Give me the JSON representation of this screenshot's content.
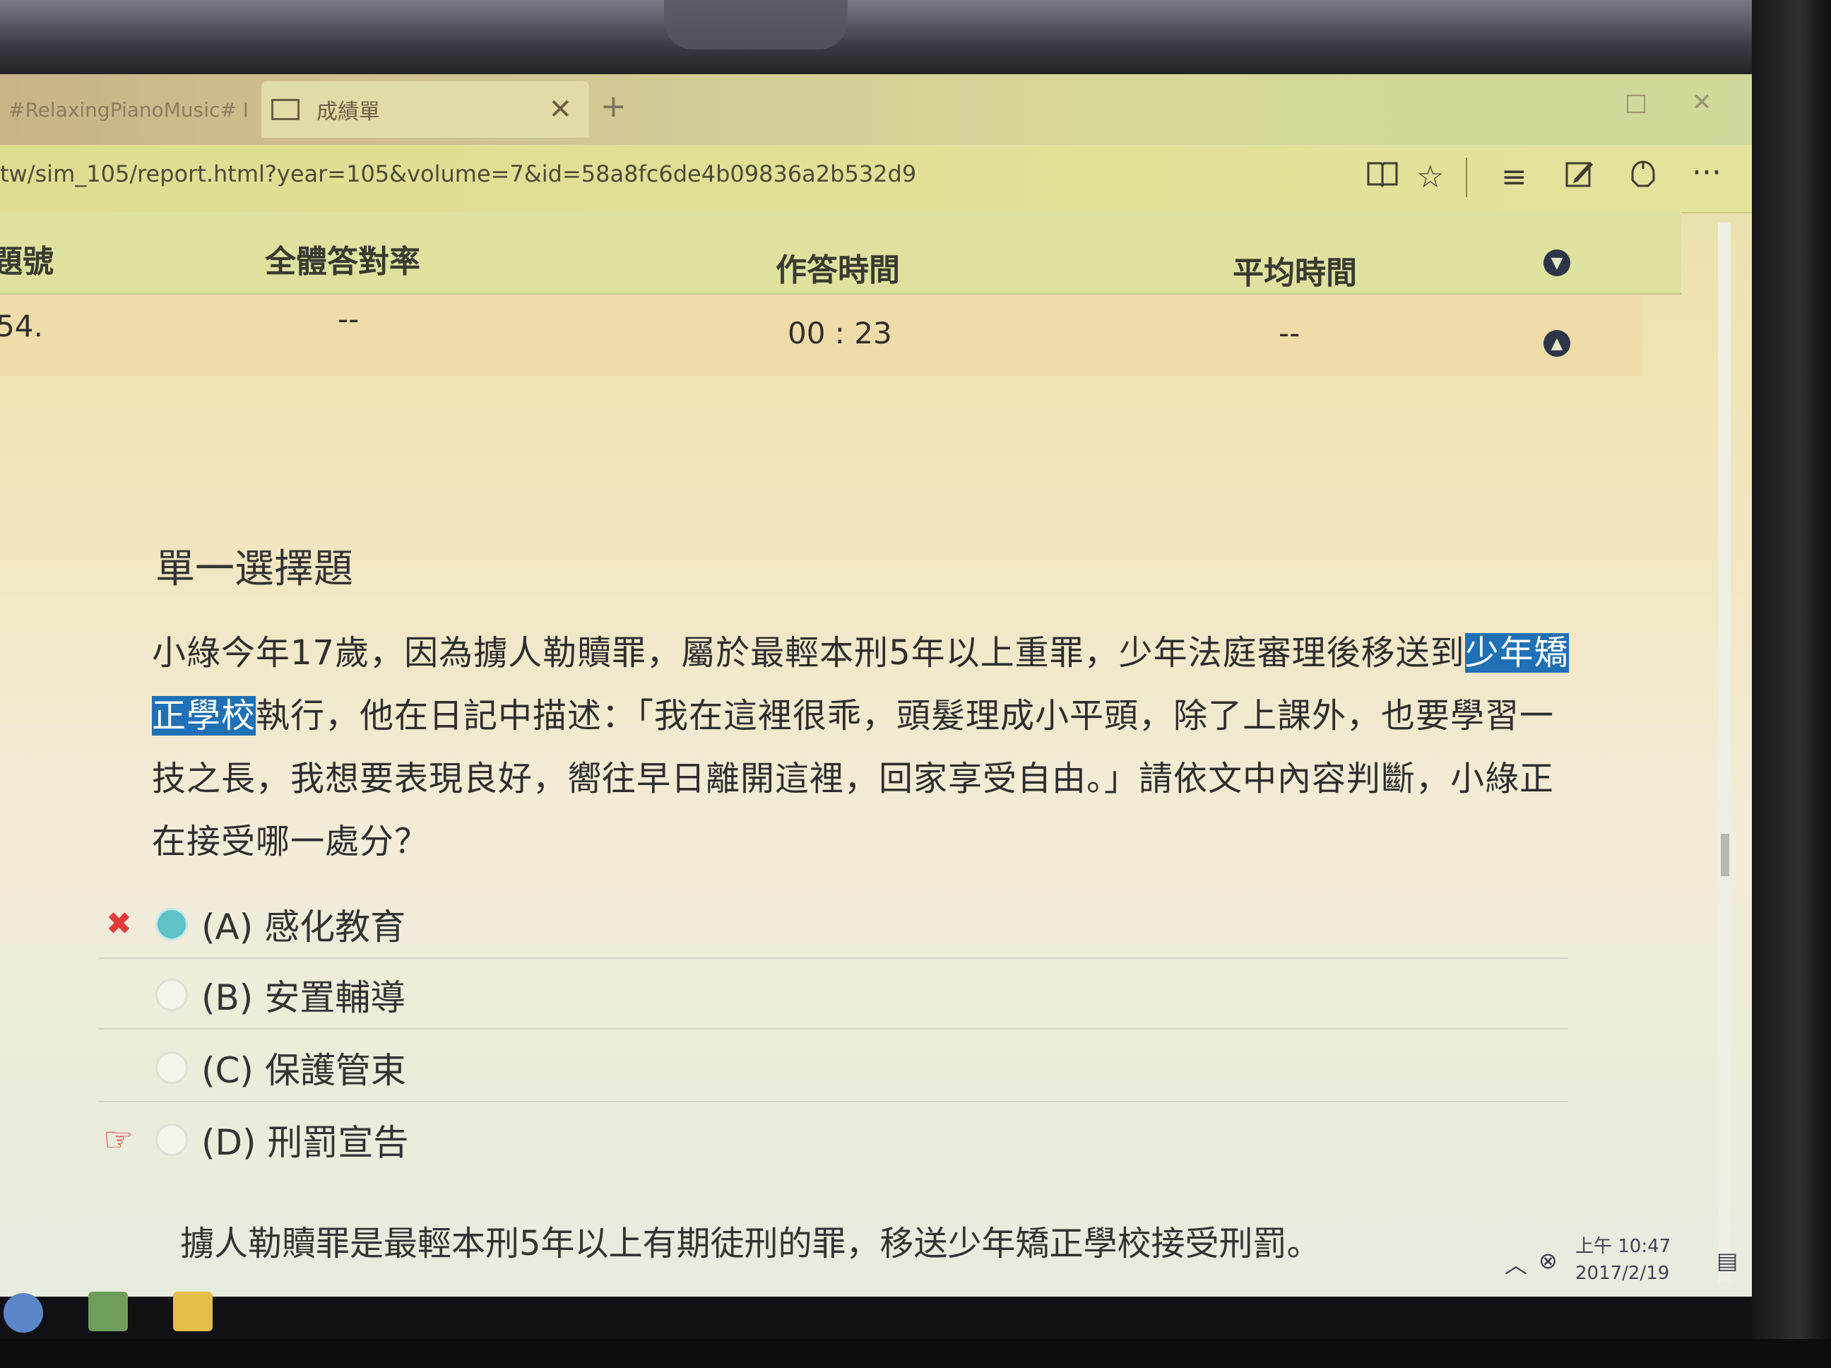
{
  "tabs": [
    {
      "label": "#RelaxingPianoMusic# I",
      "active": false
    },
    {
      "label": "成績單",
      "active": true
    }
  ],
  "new_tab_symbol": "+",
  "tab_close_symbol": "✕",
  "window_controls": {
    "restore": "□",
    "close": "✕"
  },
  "address": "tw/sim_105/report.html?year=105&volume=7&id=58a8fc6de4b09836a2b532d9",
  "toolbar": {
    "reading_view": "reading-view-icon",
    "favorite": "star-icon",
    "hub": "hub-icon",
    "web_note": "web-note-icon",
    "share": "share-icon",
    "more": "···"
  },
  "table": {
    "headers": {
      "number": "題號",
      "overall_correct_rate": "全體答對率",
      "answer_time": "作答時間",
      "average_time": "平均時間"
    },
    "row": {
      "number": "54.",
      "overall_correct_rate": "--",
      "answer_time": "00 : 23",
      "average_time": "--"
    }
  },
  "question": {
    "type": "單一選擇題",
    "text_before": "小綠今年17歲，因為擄人勒贖罪，屬於最輕本刑5年以上重罪，少年法庭審理後移送到",
    "highlighted": "少年矯正學校",
    "text_after": "執行，他在日記中描述：「我在這裡很乖，頭髮理成小平頭，除了上課外，也要學習一技之長，我想要表現良好，嚮往早日離開這裡，回家享受自由。」請依文中內容判斷，小綠正在接受哪一處分？"
  },
  "options": [
    {
      "label": "(A) 感化教育",
      "selected": true,
      "mark": "✖"
    },
    {
      "label": "(B) 安置輔導",
      "selected": false,
      "mark": ""
    },
    {
      "label": "(C) 保護管束",
      "selected": false,
      "mark": ""
    },
    {
      "label": "(D) 刑罰宣告",
      "selected": false,
      "mark": "☞"
    }
  ],
  "explanation": "擄人勒贖罪是最輕本刑5年以上有期徒刑的罪，移送少年矯正學校接受刑罰。",
  "system_tray": {
    "time": "上午 10:47",
    "date": "2017/2/19"
  },
  "colors": {
    "highlight": "#1f70b5",
    "selected_radio": "#5fc2c6",
    "wrong_mark": "#e53a3a"
  }
}
